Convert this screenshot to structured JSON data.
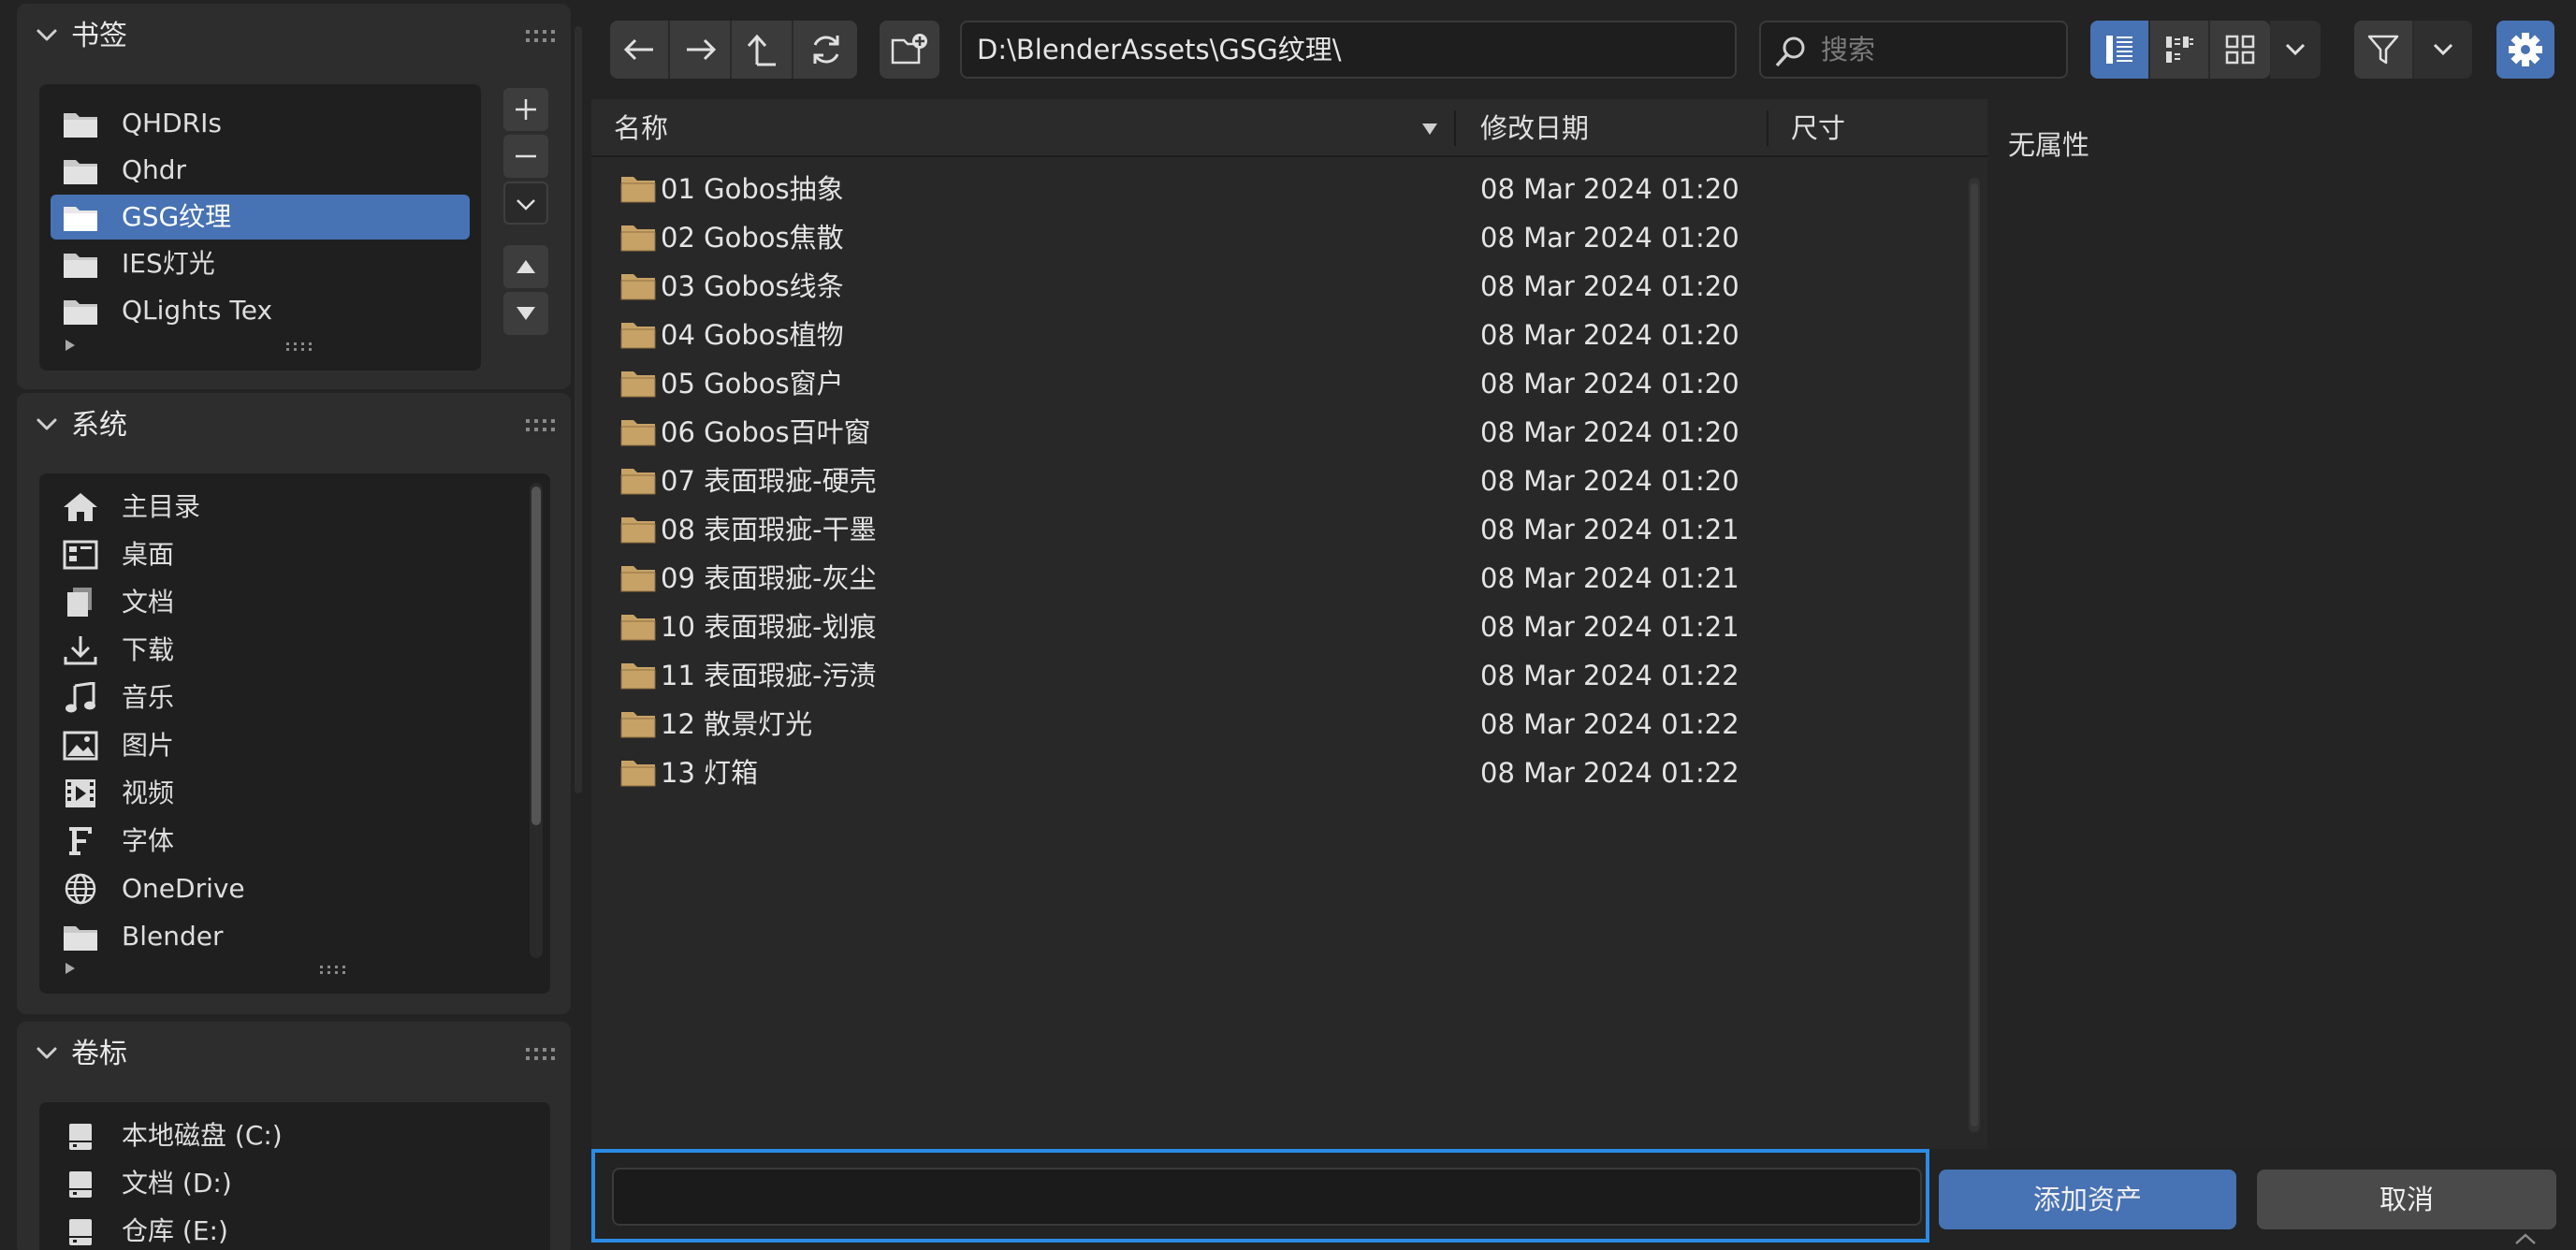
{
  "bookmarks": {
    "title": "书签",
    "items": [
      {
        "label": "QHDRIs",
        "icon": "folder-icon"
      },
      {
        "label": "Qhdr",
        "icon": "folder-icon"
      },
      {
        "label": "GSG纹理",
        "icon": "folder-icon",
        "selected": true
      },
      {
        "label": "IES灯光",
        "icon": "folder-icon"
      },
      {
        "label": "QLights Tex",
        "icon": "folder-icon"
      }
    ]
  },
  "system": {
    "title": "系统",
    "items": [
      {
        "label": "主目录",
        "icon": "home-icon"
      },
      {
        "label": "桌面",
        "icon": "desktop-icon"
      },
      {
        "label": "文档",
        "icon": "documents-icon"
      },
      {
        "label": "下载",
        "icon": "download-icon"
      },
      {
        "label": "音乐",
        "icon": "music-icon"
      },
      {
        "label": "图片",
        "icon": "image-icon"
      },
      {
        "label": "视频",
        "icon": "video-icon"
      },
      {
        "label": "字体",
        "icon": "font-icon"
      },
      {
        "label": "OneDrive",
        "icon": "globe-icon"
      },
      {
        "label": "Blender",
        "icon": "folder-icon"
      }
    ]
  },
  "volumes": {
    "title": "卷标",
    "items": [
      {
        "label": "本地磁盘 (C:)",
        "icon": "disk-icon"
      },
      {
        "label": "文档 (D:)",
        "icon": "disk-icon"
      },
      {
        "label": "仓库 (E:)",
        "icon": "disk-icon"
      }
    ]
  },
  "toolbar": {
    "path": "D:\\BlenderAssets\\GSG纹理\\",
    "search_placeholder": "搜索"
  },
  "file_list": {
    "columns": {
      "name": "名称",
      "modified": "修改日期",
      "size": "尺寸"
    },
    "rows": [
      {
        "name": "01 Gobos抽象",
        "date": "08 Mar 2024 01:20"
      },
      {
        "name": "02 Gobos焦散",
        "date": "08 Mar 2024 01:20"
      },
      {
        "name": "03 Gobos线条",
        "date": "08 Mar 2024 01:20"
      },
      {
        "name": "04 Gobos植物",
        "date": "08 Mar 2024 01:20"
      },
      {
        "name": "05 Gobos窗户",
        "date": "08 Mar 2024 01:20"
      },
      {
        "name": "06 Gobos百叶窗",
        "date": "08 Mar 2024 01:20"
      },
      {
        "name": "07 表面瑕疵-硬壳",
        "date": "08 Mar 2024 01:20"
      },
      {
        "name": "08 表面瑕疵-干墨",
        "date": "08 Mar 2024 01:21"
      },
      {
        "name": "09 表面瑕疵-灰尘",
        "date": "08 Mar 2024 01:21"
      },
      {
        "name": "10 表面瑕疵-划痕",
        "date": "08 Mar 2024 01:21"
      },
      {
        "name": "11 表面瑕疵-污渍",
        "date": "08 Mar 2024 01:22"
      },
      {
        "name": "12 散景灯光",
        "date": "08 Mar 2024 01:22"
      },
      {
        "name": "13 灯箱",
        "date": "08 Mar 2024 01:22"
      }
    ]
  },
  "properties": {
    "empty_text": "无属性"
  },
  "footer": {
    "filename_value": "",
    "confirm_label": "添加资产",
    "cancel_label": "取消"
  },
  "colors": {
    "accent": "#4772b3",
    "focus_border": "#2b8ce6",
    "folder": "#c7a266"
  }
}
